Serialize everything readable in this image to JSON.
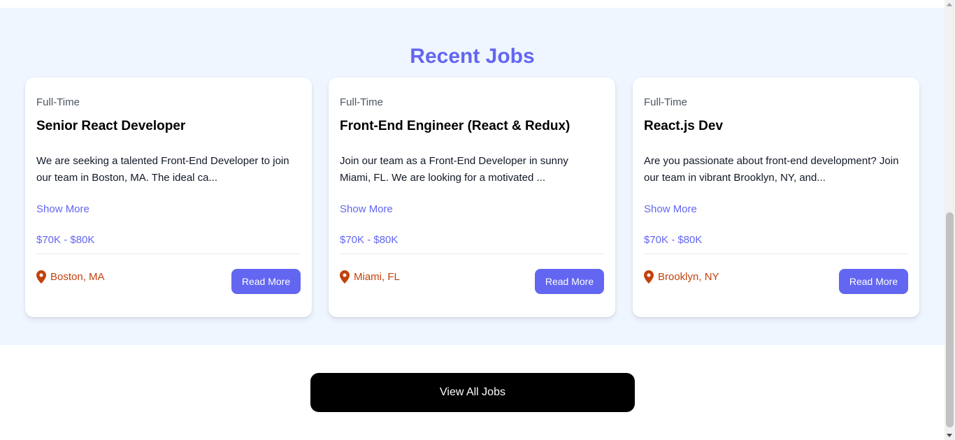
{
  "section": {
    "title": "Recent Jobs"
  },
  "jobs": [
    {
      "type": "Full-Time",
      "title": "Senior React Developer",
      "description": "We are seeking a talented Front-End Developer to join our team in Boston, MA. The ideal ca...",
      "show_more": "Show More",
      "salary": "$70K - $80K",
      "location": "Boston, MA",
      "read_more": "Read More"
    },
    {
      "type": "Full-Time",
      "title": "Front-End Engineer (React & Redux)",
      "description": "Join our team as a Front-End Developer in sunny Miami, FL. We are looking for a motivated ...",
      "show_more": "Show More",
      "salary": "$70K - $80K",
      "location": "Miami, FL",
      "read_more": "Read More"
    },
    {
      "type": "Full-Time",
      "title": "React.js Dev",
      "description": "Are you passionate about front-end development? Join our team in vibrant Brooklyn, NY, and...",
      "show_more": "Show More",
      "salary": "$70K - $80K",
      "location": "Brooklyn, NY",
      "read_more": "Read More"
    }
  ],
  "view_all": {
    "label": "View All Jobs"
  },
  "icons": {
    "location": "map-marker-icon"
  },
  "colors": {
    "accent": "#6366f1",
    "section_bg": "#eff6ff",
    "location": "#c2410c",
    "view_all_bg": "#000000"
  }
}
